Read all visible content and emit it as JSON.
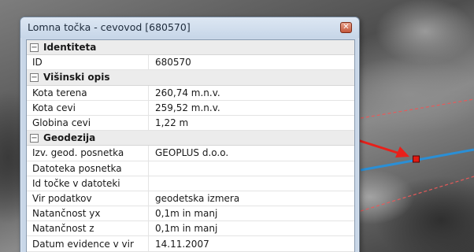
{
  "window": {
    "title": "Lomna točka - cevovod [680570]",
    "close_glyph": "✕"
  },
  "groups": [
    {
      "label": "Identiteta",
      "toggle_glyph": "−",
      "rows": [
        {
          "key": "ID",
          "value": "680570"
        }
      ]
    },
    {
      "label": "Višinski opis",
      "toggle_glyph": "−",
      "rows": [
        {
          "key": "Kota terena",
          "value": "260,74 m.n.v."
        },
        {
          "key": "Kota cevi",
          "value": "259,52 m.n.v."
        },
        {
          "key": "Globina cevi",
          "value": "1,22 m"
        }
      ]
    },
    {
      "label": "Geodezija",
      "toggle_glyph": "−",
      "rows": [
        {
          "key": "Izv. geod. posnetka",
          "value": "GEOPLUS d.o.o."
        },
        {
          "key": "Datoteka posnetka",
          "value": ""
        },
        {
          "key": "Id točke v datoteki",
          "value": ""
        },
        {
          "key": "Vir podatkov",
          "value": "geodetska izmera"
        },
        {
          "key": "Natančnost yx",
          "value": "0,1m in manj"
        },
        {
          "key": "Natančnost z",
          "value": "0,1m in manj"
        },
        {
          "key": "Datum evidence v vir",
          "value": "14.11.2007"
        }
      ]
    }
  ],
  "colors": {
    "arrow": "#e8201a",
    "pipeline": "#2a8fd6",
    "parcel_line": "#e65a5a",
    "point_fill": "#e01a12"
  },
  "map_icons": [
    "pipeline-line",
    "parcel-boundary-line",
    "break-point-marker",
    "pointer-arrow"
  ]
}
